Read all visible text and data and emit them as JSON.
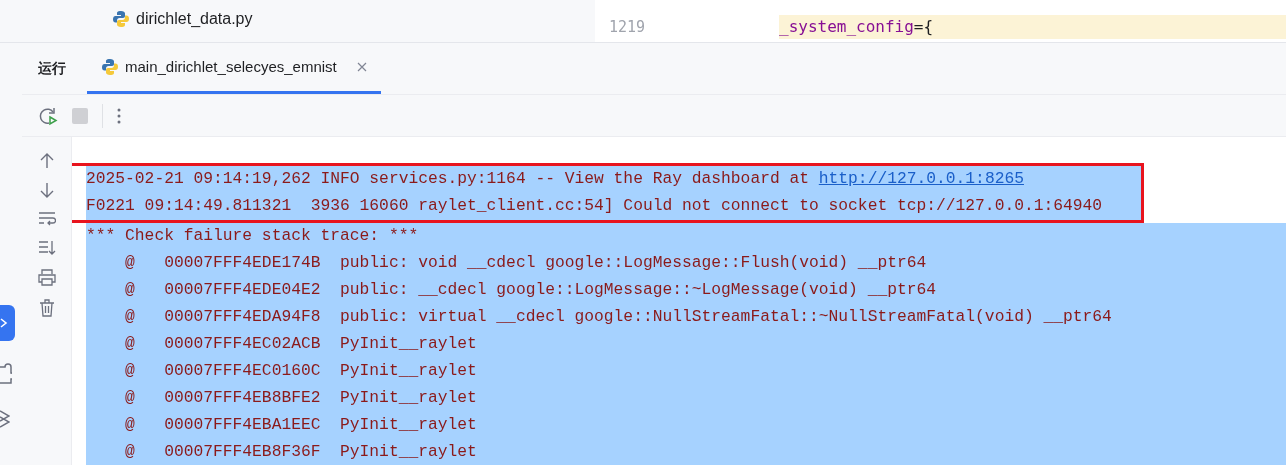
{
  "project_tree": {
    "items": [
      {
        "name": "dirichlet_data.py"
      }
    ]
  },
  "editor": {
    "lines": [
      {
        "number": "1219",
        "code": "_system_config={",
        "current": true
      }
    ]
  },
  "run_panel": {
    "title": "运行",
    "tabs": [
      {
        "label": "main_dirichlet_selecyes_emnist",
        "selected": true
      }
    ],
    "console": {
      "lines": [
        {
          "text": "2025-02-21 09:14:19,262 INFO services.py:1164 -- View the Ray dashboard at ",
          "link": "http://127.0.0.1:8265",
          "selected": true,
          "boxed": true
        },
        {
          "text": "F0221 09:14:49.811321  3936 16060 raylet_client.cc:54] Could not connect to socket tcp://127.0.0.1:64940",
          "selected": true,
          "boxed": true
        },
        {
          "text": "*** Check failure stack trace: ***",
          "selected": true,
          "boxed": false
        },
        {
          "text": "    @   00007FFF4EDE174B  public: void __cdecl google::LogMessage::Flush(void) __ptr64",
          "selected": true,
          "boxed": false
        },
        {
          "text": "    @   00007FFF4EDE04E2  public: __cdecl google::LogMessage::~LogMessage(void) __ptr64",
          "selected": true,
          "boxed": false
        },
        {
          "text": "    @   00007FFF4EDA94F8  public: virtual __cdecl google::NullStreamFatal::~NullStreamFatal(void) __ptr64",
          "selected": true,
          "boxed": false
        },
        {
          "text": "    @   00007FFF4EC02ACB  PyInit__raylet",
          "selected": true,
          "boxed": false
        },
        {
          "text": "    @   00007FFF4EC0160C  PyInit__raylet",
          "selected": true,
          "boxed": false
        },
        {
          "text": "    @   00007FFF4EB8BFE2  PyInit__raylet",
          "selected": true,
          "boxed": false
        },
        {
          "text": "    @   00007FFF4EBA1EEC  PyInit__raylet",
          "selected": true,
          "boxed": false
        },
        {
          "text": "    @   00007FFF4EB8F36F  PyInit__raylet",
          "selected": true,
          "boxed": false
        }
      ]
    }
  }
}
